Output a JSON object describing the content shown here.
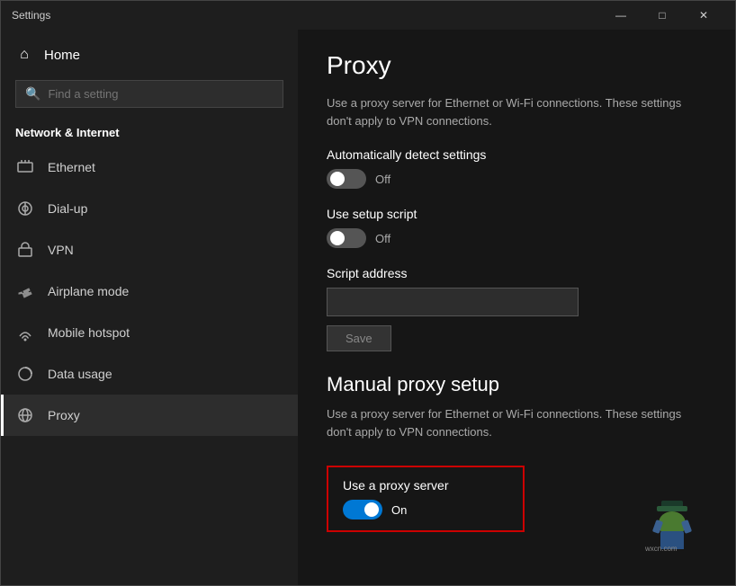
{
  "window": {
    "title": "Settings",
    "controls": {
      "minimize": "—",
      "maximize": "□",
      "close": "✕"
    }
  },
  "sidebar": {
    "home_label": "Home",
    "search_placeholder": "Find a setting",
    "section_title": "Network & Internet",
    "items": [
      {
        "id": "ethernet",
        "label": "Ethernet",
        "icon": "ethernet"
      },
      {
        "id": "dialup",
        "label": "Dial-up",
        "icon": "dialup"
      },
      {
        "id": "vpn",
        "label": "VPN",
        "icon": "vpn"
      },
      {
        "id": "airplane",
        "label": "Airplane mode",
        "icon": "airplane"
      },
      {
        "id": "hotspot",
        "label": "Mobile hotspot",
        "icon": "hotspot"
      },
      {
        "id": "datausage",
        "label": "Data usage",
        "icon": "data"
      },
      {
        "id": "proxy",
        "label": "Proxy",
        "icon": "proxy",
        "active": true
      }
    ]
  },
  "content": {
    "page_title": "Proxy",
    "auto_section": {
      "description": "Use a proxy server for Ethernet or Wi-Fi connections. These settings don't apply to VPN connections.",
      "auto_detect_label": "Automatically detect settings",
      "auto_detect_status": "Off",
      "auto_detect_on": false,
      "setup_script_label": "Use setup script",
      "setup_script_status": "Off",
      "setup_script_on": false,
      "script_address_label": "Script address",
      "script_address_placeholder": "",
      "save_button_label": "Save"
    },
    "manual_section": {
      "title": "Manual proxy setup",
      "description": "Use a proxy server for Ethernet or Wi-Fi connections. These settings don't apply to VPN connections.",
      "use_proxy_label": "Use a proxy server",
      "use_proxy_status": "On",
      "use_proxy_on": true
    }
  },
  "watermark": {
    "text": "wxcn.com"
  }
}
